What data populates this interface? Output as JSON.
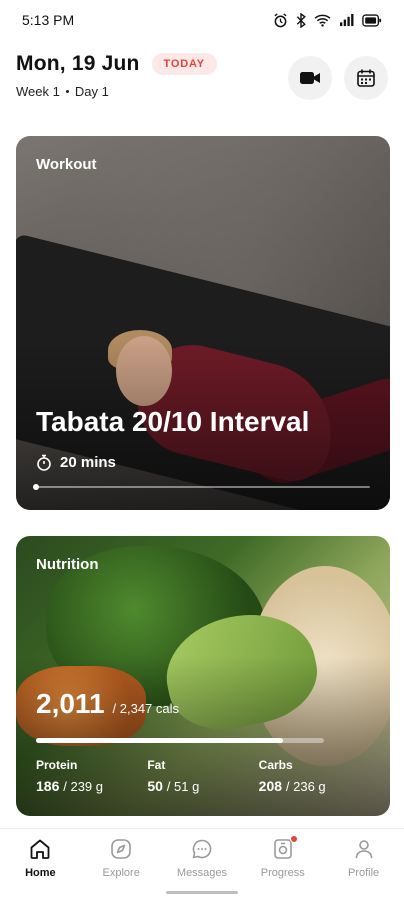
{
  "status": {
    "time": "5:13 PM",
    "battery": "85"
  },
  "header": {
    "date": "Mon, 19 Jun",
    "badge": "TODAY",
    "week": "Week 1",
    "day": "Day 1"
  },
  "workout": {
    "label": "Workout",
    "title": "Tabata 20/10 Interval",
    "duration": "20 mins",
    "progress": 0.0
  },
  "nutrition": {
    "label": "Nutrition",
    "calories": "2,011",
    "calories_target": "/ 2,347 cals",
    "calories_fraction": 0.857,
    "macros": [
      {
        "label": "Protein",
        "value": "186",
        "total": "/ 239 g"
      },
      {
        "label": "Fat",
        "value": "50",
        "total": "/ 51 g"
      },
      {
        "label": "Carbs",
        "value": "208",
        "total": "/ 236 g"
      }
    ]
  },
  "nav": [
    {
      "label": "Home",
      "icon": "home-icon",
      "active": true
    },
    {
      "label": "Explore",
      "icon": "compass-icon",
      "active": false
    },
    {
      "label": "Messages",
      "icon": "message-icon",
      "active": false
    },
    {
      "label": "Progress",
      "icon": "progress-icon",
      "active": false,
      "badge": true
    },
    {
      "label": "Profile",
      "icon": "profile-icon",
      "active": false
    }
  ],
  "colors": {
    "accent": "#e0443e",
    "badge_bg": "#fde8e8"
  }
}
